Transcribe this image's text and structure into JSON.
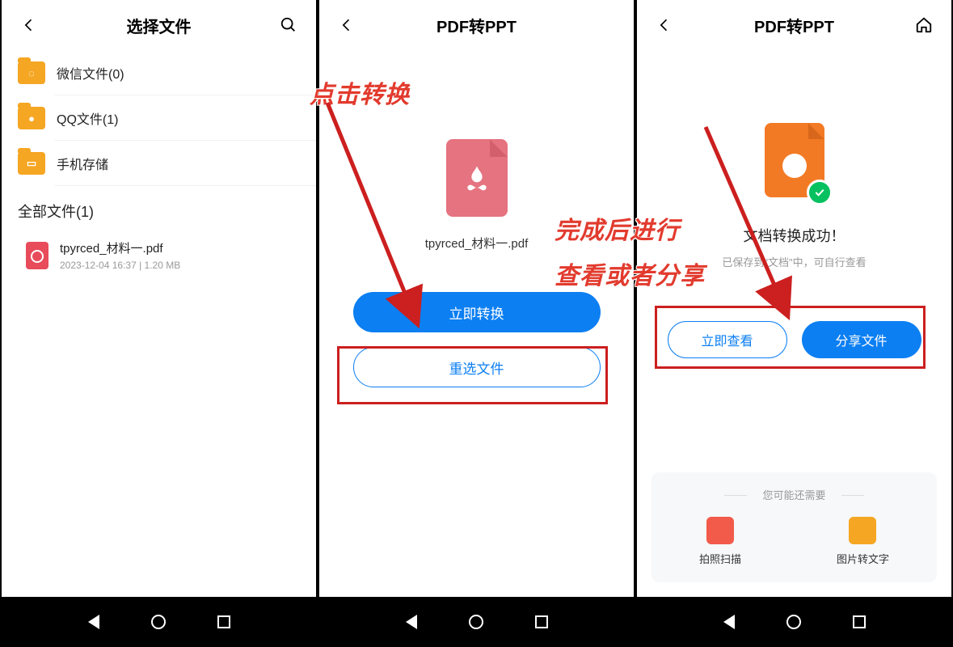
{
  "panel1": {
    "title": "选择文件",
    "folders": [
      {
        "label": "微信文件(0)",
        "glyph": "◌"
      },
      {
        "label": "QQ文件(1)",
        "glyph": "●"
      },
      {
        "label": "手机存储",
        "glyph": "▭"
      }
    ],
    "section": "全部文件(1)",
    "file": {
      "name": "tpyrced_材料一.pdf",
      "meta": "2023-12-04 16:37  |  1.20 MB"
    }
  },
  "panel2": {
    "title": "PDF转PPT",
    "file_name": "tpyrced_材料一.pdf",
    "primary_btn": "立即转换",
    "secondary_btn": "重选文件",
    "annotation": "点击转换"
  },
  "panel3": {
    "title": "PDF转PPT",
    "success_title": "文档转换成功！",
    "success_sub": "已保存到\"文档\"中，可自行查看",
    "view_btn": "立即查看",
    "share_btn": "分享文件",
    "annotation_line1": "完成后进行",
    "annotation_line2": "查看或者分享",
    "suggest_title": "您可能还需要",
    "suggest1": "拍照扫描",
    "suggest2": "图片转文字"
  }
}
